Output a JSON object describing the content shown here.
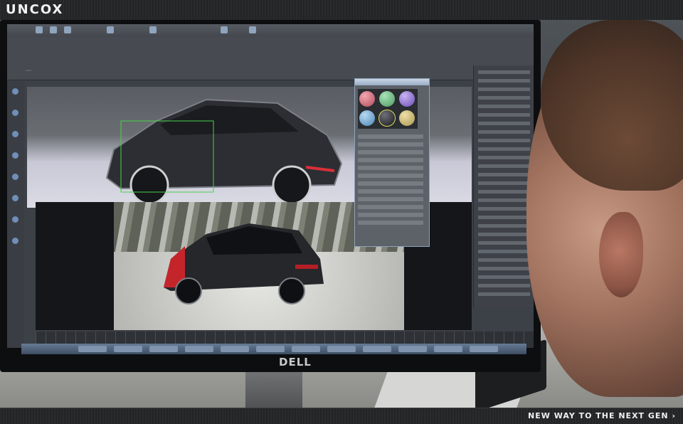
{
  "header": {
    "logo": "UNCOX"
  },
  "monitor": {
    "brand": "DELL"
  },
  "footer": {
    "tagline": "NEW WAY TO THE NEXT GEN ›"
  }
}
